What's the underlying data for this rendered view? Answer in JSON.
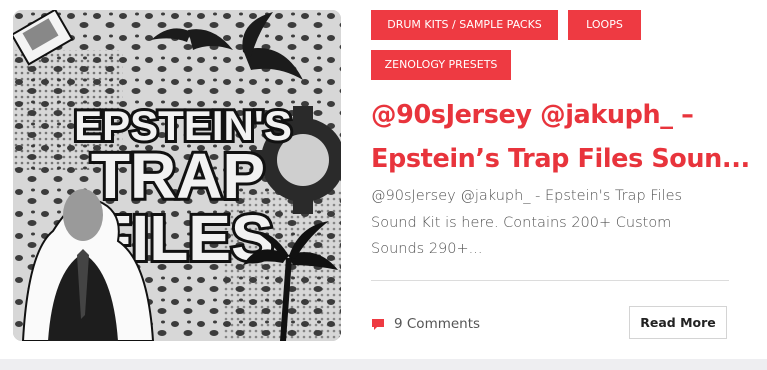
{
  "post": {
    "categories": [
      "DRUM KITS / SAMPLE PACKS",
      "LOOPS",
      "ZENOLOGY PRESETS"
    ],
    "title_lines": [
      "@90sJersey @jakuph_ –",
      "Epstein’s Trap Files Soun..."
    ],
    "excerpt_lines": [
      "@90sJersey @jakuph_ - Epstein's Trap Files",
      "Sound Kit is here. Contains 200+ Custom",
      "Sounds 290+..."
    ],
    "comments_label": "9 Comments",
    "comment_icon": "speech-bubble-icon",
    "read_more_label": "Read More"
  },
  "thumbnail": {
    "art_text_lines": [
      "EPSTEIN'S",
      "TRAP",
      "FILES"
    ]
  },
  "colors": {
    "accent": "#ee3a42",
    "title": "#e8343c",
    "text": "#555555",
    "border": "#d4d4d4"
  }
}
